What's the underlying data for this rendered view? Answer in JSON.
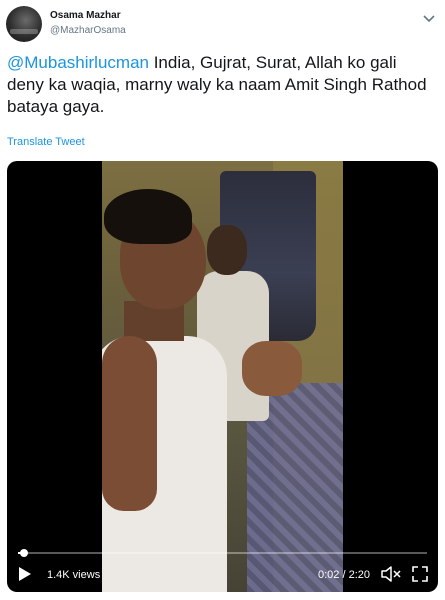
{
  "tweet": {
    "author_name": "Osama Mazhar",
    "author_handle": "@MazharOsama",
    "mention": "@Mubashirlucman",
    "body": " India, Gujrat, Surat, Allah ko gali deny ka waqia, marny waly ka naam Amit Singh Rathod bataya gaya.",
    "translate_label": "Translate Tweet"
  },
  "video": {
    "views": "1.4K views",
    "time": "0:02 / 2:20",
    "progress_fraction": 0.015
  },
  "colors": {
    "link": "#1b95e0",
    "secondary": "#657786",
    "text": "#14171a"
  },
  "icons": [
    "chevron-down-icon",
    "play-icon",
    "mute-icon",
    "fullscreen-icon"
  ]
}
